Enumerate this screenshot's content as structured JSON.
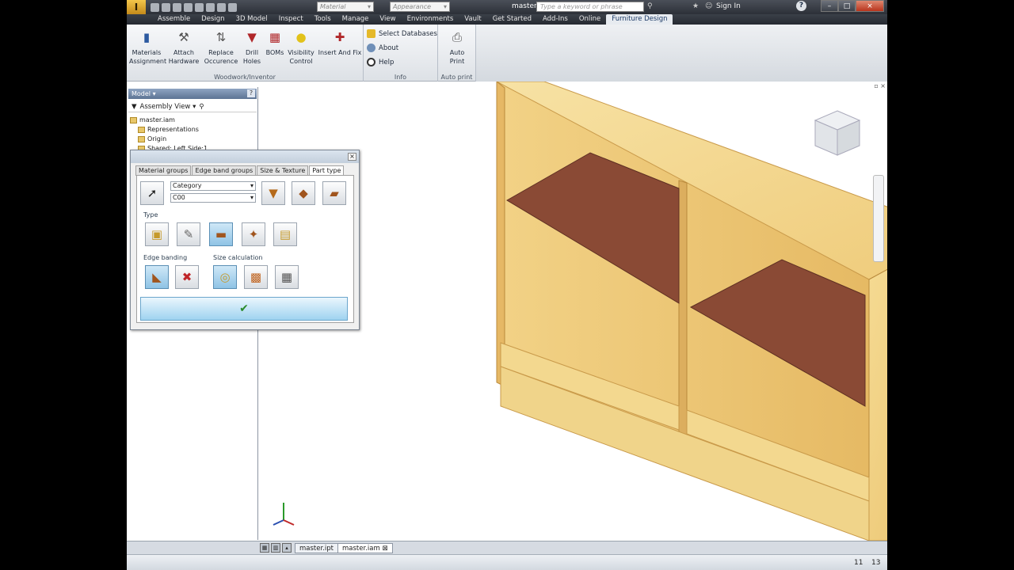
{
  "titlebar": {
    "logo": "I",
    "material_placeholder": "Material",
    "appearance_placeholder": "Appearance",
    "doc_title": "master.iam",
    "search_placeholder": "Type a keyword or phrase",
    "sign_in": "Sign In",
    "help": "?"
  },
  "tabs": [
    "Assemble",
    "Design",
    "3D Model",
    "Inspect",
    "Tools",
    "Manage",
    "View",
    "Environments",
    "Vault",
    "Get Started",
    "Add-Ins",
    "Online",
    "Furniture Design"
  ],
  "active_tab": "Furniture Design",
  "ribbon": {
    "woodwork_group": {
      "label": "Woodwork/Inventor",
      "buttons": [
        {
          "line1": "Materials",
          "line2": "Assignment"
        },
        {
          "line1": "Attach",
          "line2": "Hardware"
        },
        {
          "line1": "Replace",
          "line2": "Occurence"
        },
        {
          "line1": "Drill",
          "line2": "Holes"
        },
        {
          "line1": "BOMs",
          "line2": ""
        },
        {
          "line1": "Visibility",
          "line2": "Control"
        },
        {
          "line1": "Insert And Fix",
          "line2": ""
        }
      ]
    },
    "info_group": {
      "label": "Info",
      "items": [
        "Select Databases",
        "About",
        "Help"
      ]
    },
    "autoprint_group": {
      "label": "Auto print",
      "button_line1": "Auto",
      "button_line2": "Print"
    }
  },
  "browser": {
    "header": "Model ▾",
    "help": "?",
    "view_label": "Assembly View",
    "tree": [
      "master.iam",
      "Representations",
      "Origin",
      "Shared: Left Side:1"
    ]
  },
  "dialog": {
    "close": "×",
    "tabs": [
      "Material groups",
      "Edge band groups",
      "Size & Texture",
      "Part type"
    ],
    "active_tab": "Part type",
    "category_value": "Category",
    "code_value": "C00",
    "type_label": "Type",
    "edge_label": "Edge banding",
    "size_label": "Size calculation"
  },
  "doc_tabs": [
    "master.ipt",
    "master.iam"
  ],
  "status": {
    "left_number": "11",
    "right_number": "13"
  },
  "colors": {
    "accent": "#1c3a66",
    "panel_wood": "#f1cf7c",
    "shelf": "#8a4a35"
  }
}
